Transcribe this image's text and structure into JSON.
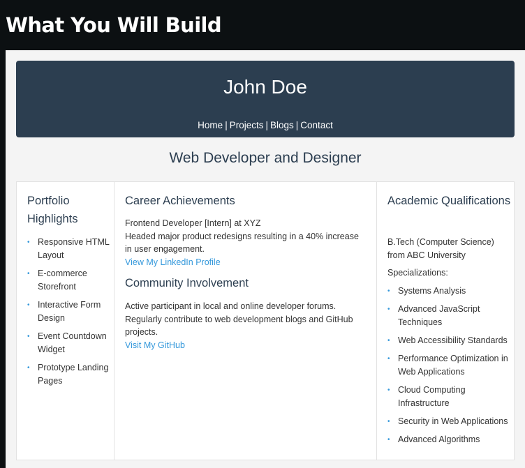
{
  "page": {
    "heading": "What You Will Build"
  },
  "header": {
    "name": "John Doe",
    "nav": [
      {
        "label": "Home"
      },
      {
        "label": "Projects"
      },
      {
        "label": "Blogs"
      },
      {
        "label": "Contact"
      }
    ],
    "separator": "|"
  },
  "tagline": "Web Developer and Designer",
  "portfolio": {
    "title": "Portfolio Highlights",
    "items": [
      "Responsive HTML Layout",
      "E-commerce Storefront",
      "Interactive Form Design",
      "Event Countdown Widget",
      "Prototype Landing Pages"
    ]
  },
  "career": {
    "title": "Career Achievements",
    "role": "Frontend Developer [Intern] at XYZ",
    "description": "Headed major product redesigns resulting in a 40% increase in user engagement.",
    "link": "View My LinkedIn Profile"
  },
  "community": {
    "title": "Community Involvement",
    "description": "Active participant in local and online developer forums. Regularly contribute to web development blogs and GitHub projects.",
    "link": "Visit My GitHub"
  },
  "academic": {
    "title": "Academic Qualifications",
    "degree": "B.Tech (Computer Science) from ABC University",
    "specializations_label": "Specializations:",
    "items": [
      "Systems Analysis",
      "Advanced JavaScript Techniques",
      "Web Accessibility Standards",
      "Performance Optimization in Web Applications",
      "Cloud Computing Infrastructure",
      "Security in Web Applications",
      "Advanced Algorithms"
    ]
  },
  "colors": {
    "header_bg": "#2c3e50",
    "accent": "#3498db",
    "page_bg": "#0c1012"
  },
  "icons": {
    "list_bullet": "bullet-icon"
  }
}
